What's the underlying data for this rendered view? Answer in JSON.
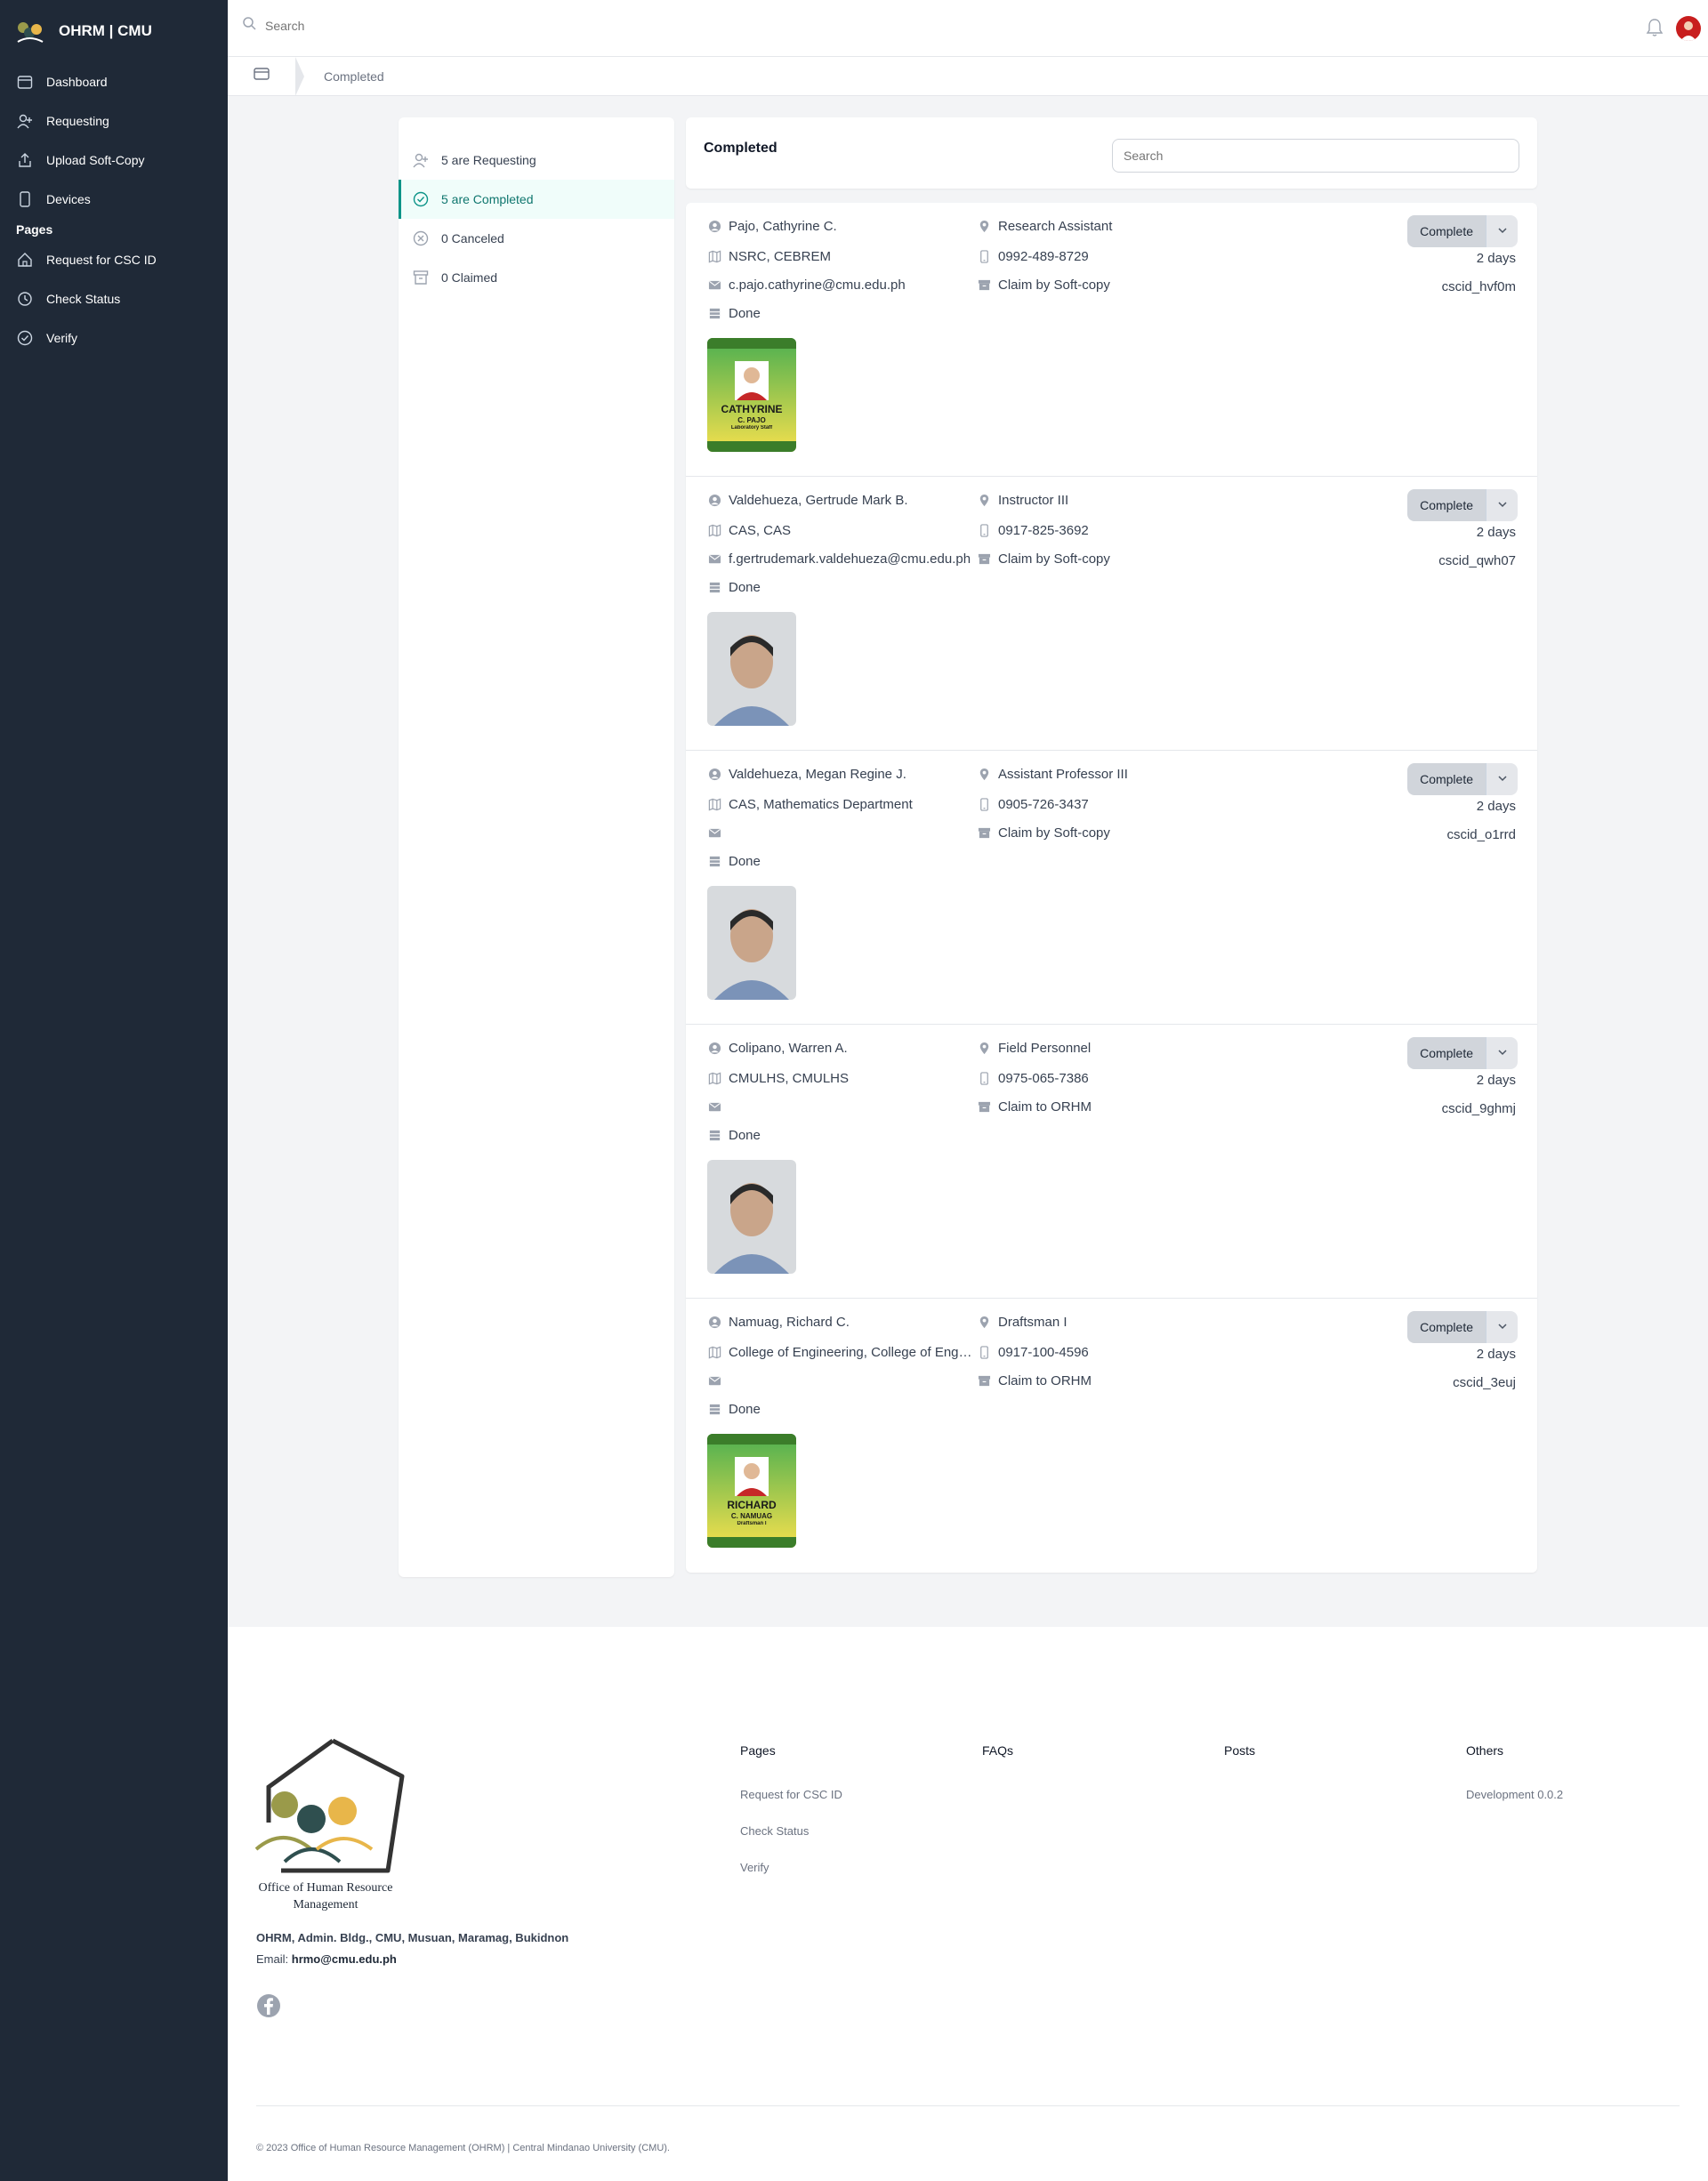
{
  "app": {
    "title": "OHRM | CMU"
  },
  "sidebar": {
    "items": [
      {
        "label": "Dashboard",
        "icon": "calendar-icon"
      },
      {
        "label": "Requesting",
        "icon": "user-plus-icon"
      },
      {
        "label": "Upload Soft-Copy",
        "icon": "upload-icon"
      },
      {
        "label": "Devices",
        "icon": "device-icon"
      }
    ],
    "section_label": "Pages",
    "pages": [
      {
        "label": "Request for CSC ID",
        "icon": "home-icon"
      },
      {
        "label": "Check Status",
        "icon": "clock-icon"
      },
      {
        "label": "Verify",
        "icon": "check-circle-icon"
      }
    ]
  },
  "topbar": {
    "search_placeholder": "Search"
  },
  "breadcrumb": {
    "current": "Completed"
  },
  "filters": [
    {
      "label": "5 are Requesting",
      "icon": "user-plus-icon",
      "active": false
    },
    {
      "label": "5 are Completed",
      "icon": "check-circle-icon",
      "active": true
    },
    {
      "label": "0 Canceled",
      "icon": "x-circle-icon",
      "active": false
    },
    {
      "label": "0 Claimed",
      "icon": "archive-icon",
      "active": false
    }
  ],
  "main": {
    "title": "Completed",
    "search_placeholder": "Search",
    "button_label": "Complete",
    "records": [
      {
        "name": "Pajo, Cathyrine C.",
        "office": "NSRC, CEBREM",
        "email": "c.pajo.cathyrine@cmu.edu.ph",
        "status": "Done",
        "position": "Research Assistant",
        "phone": "0992-489-8729",
        "claim": "Claim by Soft-copy",
        "age": "2 days",
        "cscid": "cscid_hvf0m",
        "photo": "id-card",
        "card_name": "CATHYRINE",
        "card_sub": "C. PAJO",
        "card_role": "Laboratory Staff"
      },
      {
        "name": "Valdehueza, Gertrude Mark B.",
        "office": "CAS, CAS",
        "email": "f.gertrudemark.valdehueza@cmu.edu.ph",
        "status": "Done",
        "position": "Instructor III",
        "phone": "0917-825-3692",
        "claim": "Claim by Soft-copy",
        "age": "2 days",
        "cscid": "cscid_qwh07",
        "photo": "portrait"
      },
      {
        "name": "Valdehueza, Megan Regine J.",
        "office": "CAS, Mathematics Department",
        "email": "",
        "status": "Done",
        "position": "Assistant Professor III",
        "phone": "0905-726-3437",
        "claim": "Claim by Soft-copy",
        "age": "2 days",
        "cscid": "cscid_o1rrd",
        "photo": "portrait"
      },
      {
        "name": "Colipano, Warren A.",
        "office": "CMULHS, CMULHS",
        "email": "",
        "status": "Done",
        "position": "Field Personnel",
        "phone": "0975-065-7386",
        "claim": "Claim to ORHM",
        "age": "2 days",
        "cscid": "cscid_9ghmj",
        "photo": "portrait"
      },
      {
        "name": "Namuag, Richard C.",
        "office": "College of Engineering, College of Engineering",
        "email": "",
        "status": "Done",
        "position": "Draftsman I",
        "phone": "0917-100-4596",
        "claim": "Claim to ORHM",
        "age": "2 days",
        "cscid": "cscid_3euj",
        "photo": "id-card",
        "card_name": "RICHARD",
        "card_sub": "C. NAMUAG",
        "card_role": "Draftsman I"
      }
    ]
  },
  "footer": {
    "org_name": "Office of Human Resource Management",
    "address": "OHRM, Admin. Bldg., CMU, Musuan, Maramag, Bukidnon",
    "email_label": "Email:",
    "email": "hrmo@cmu.edu.ph",
    "columns": [
      {
        "title": "Pages",
        "links": [
          "Request for CSC ID",
          "Check Status",
          "Verify"
        ]
      },
      {
        "title": "FAQs",
        "links": []
      },
      {
        "title": "Posts",
        "links": []
      },
      {
        "title": "Others",
        "links": [
          "Development 0.0.2"
        ]
      }
    ],
    "copyright": "© 2023 Office of Human Resource Management (OHRM) | Central Mindanao University (CMU)."
  },
  "colors": {
    "sidebar": "#1f2937",
    "accent": "#0d9488",
    "button": "#d1d5db"
  }
}
